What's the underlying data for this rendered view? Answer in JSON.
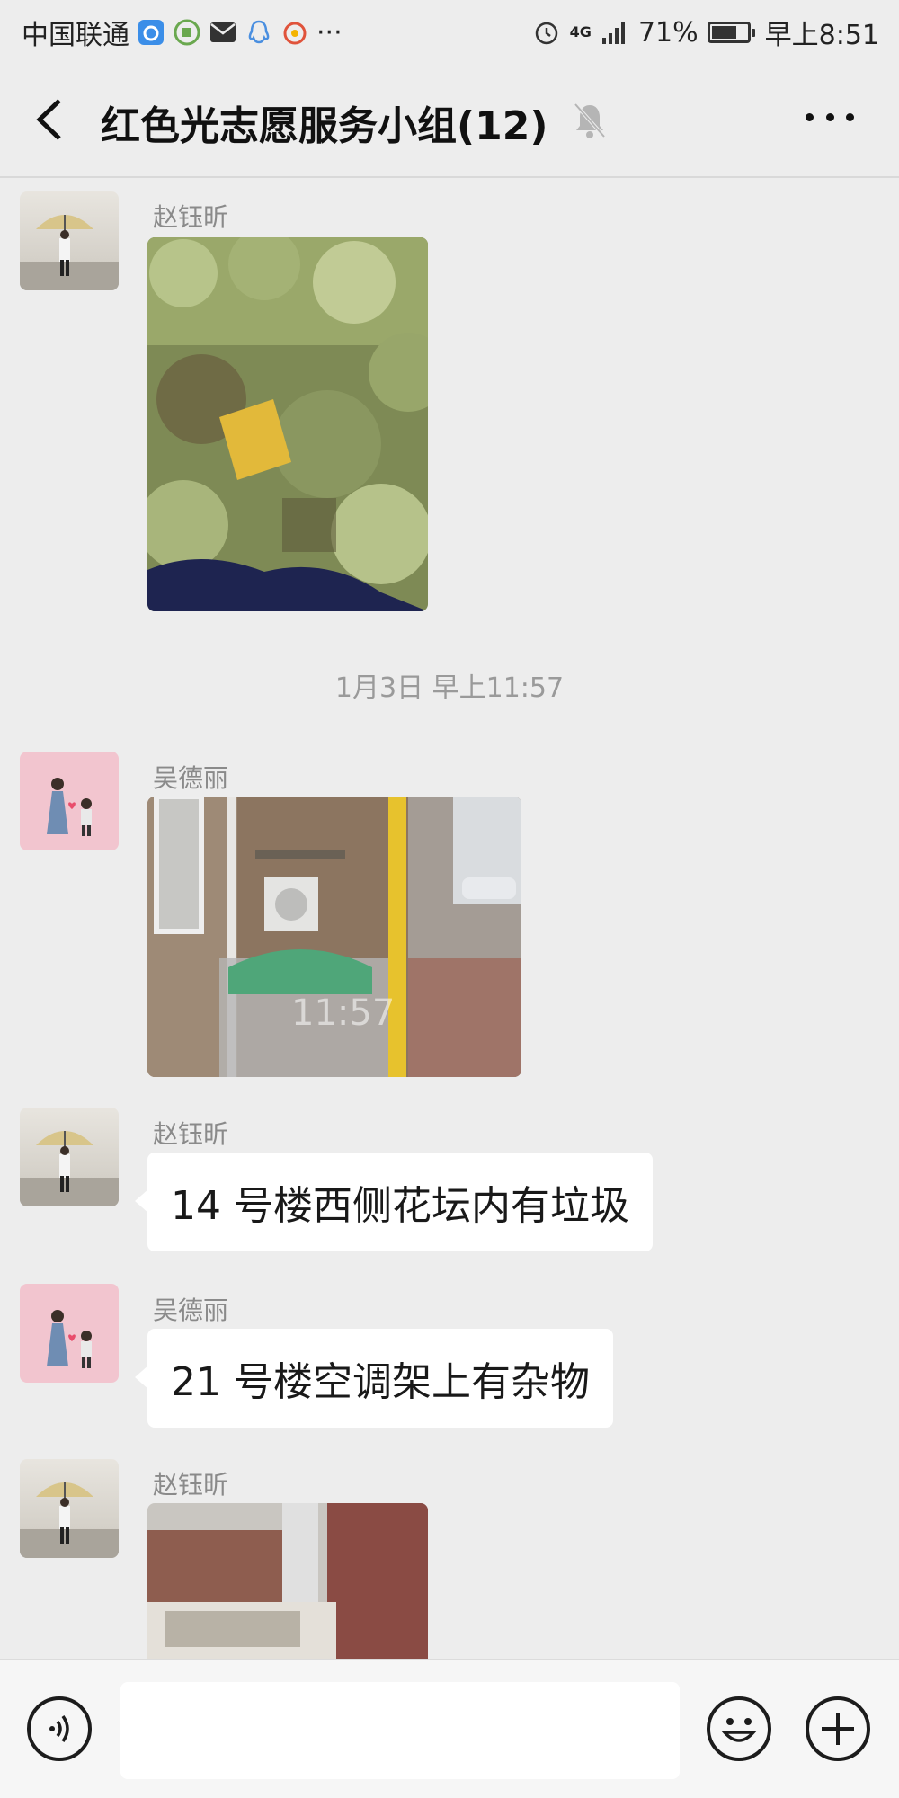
{
  "status_bar": {
    "carrier": "中国联通",
    "more": "···",
    "network": "4G",
    "battery_percent": "71%",
    "battery_level": 0.71,
    "time": "早上8:51"
  },
  "header": {
    "title": "红色光志愿服务小组(12)",
    "muted": true
  },
  "messages": [
    {
      "sender": "赵钰昕",
      "type": "image",
      "avatar": "umbrella-person"
    },
    {
      "type": "timestamp",
      "text": "1月3日 早上11:57"
    },
    {
      "sender": "吴德丽",
      "type": "image",
      "avatar": "mother-child",
      "image_overlay": "11:57"
    },
    {
      "sender": "赵钰昕",
      "type": "text",
      "text": "14 号楼西侧花坛内有垃圾",
      "avatar": "umbrella-person"
    },
    {
      "sender": "吴德丽",
      "type": "text",
      "text": "21 号楼空调架上有杂物",
      "avatar": "mother-child"
    },
    {
      "sender": "赵钰昕",
      "type": "image",
      "avatar": "umbrella-person"
    }
  ],
  "colors": {
    "background": "#ededed",
    "bubble": "#ffffff",
    "sender_name": "#8a8a8a"
  }
}
